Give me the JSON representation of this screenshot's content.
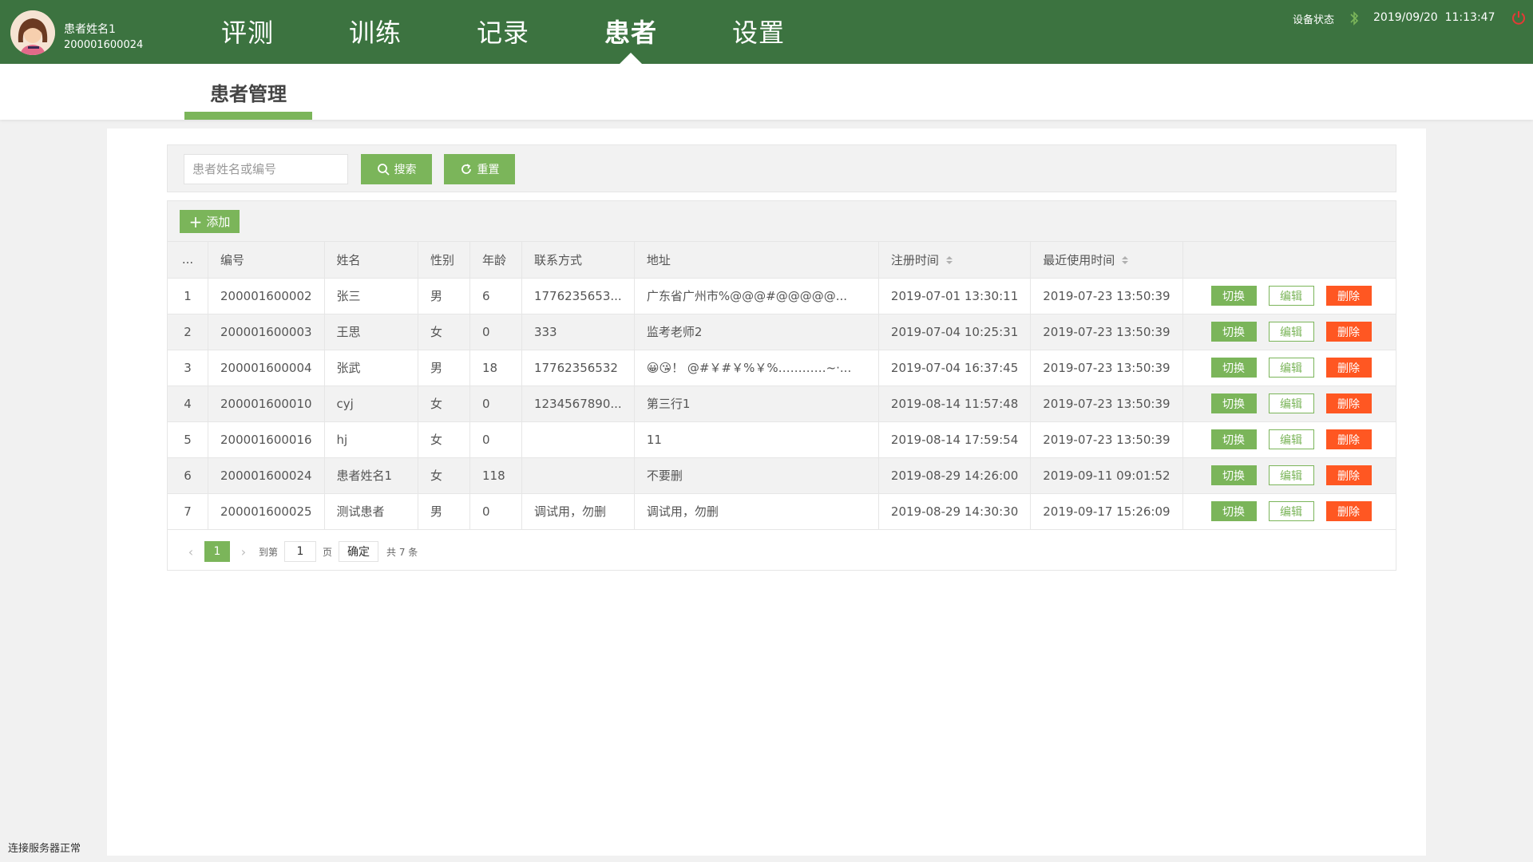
{
  "user": {
    "name": "患者姓名1",
    "id": "200001600024"
  },
  "nav": {
    "items": [
      {
        "label": "评测",
        "active": false
      },
      {
        "label": "训练",
        "active": false
      },
      {
        "label": "记录",
        "active": false
      },
      {
        "label": "患者",
        "active": true
      },
      {
        "label": "设置",
        "active": false
      }
    ]
  },
  "status": {
    "device_label": "设备状态",
    "date": "2019/09/20",
    "time": "11:13:47",
    "power_color": "#e53935",
    "bluetooth_color": "#7bb55a"
  },
  "subnav": {
    "tab": "患者管理"
  },
  "search": {
    "placeholder": "患者姓名或编号",
    "search_label": "搜索",
    "reset_label": "重置"
  },
  "toolbar": {
    "add_label": "添加"
  },
  "table": {
    "columns": [
      "...",
      "编号",
      "姓名",
      "性别",
      "年龄",
      "联系方式",
      "地址",
      "注册时间",
      "最近使用时间",
      ""
    ],
    "rows": [
      {
        "idx": "1",
        "id": "200001600002",
        "name": "张三",
        "gender": "男",
        "age": "6",
        "contact": "1776235653...",
        "address": "广东省广州市%@@@#@@@@@...",
        "registered": "2019-07-01 13:30:11",
        "last_used": "2019-07-23 13:50:39"
      },
      {
        "idx": "2",
        "id": "200001600003",
        "name": "王思",
        "gender": "女",
        "age": "0",
        "contact": "333",
        "address": "监考老师2",
        "registered": "2019-07-04 10:25:31",
        "last_used": "2019-07-23 13:50:39"
      },
      {
        "idx": "3",
        "id": "200001600004",
        "name": "张武",
        "gender": "男",
        "age": "18",
        "contact": "17762356532",
        "address": "😀😘！ @#￥#￥%￥%…………~·...",
        "registered": "2019-07-04 16:37:45",
        "last_used": "2019-07-23 13:50:39"
      },
      {
        "idx": "4",
        "id": "200001600010",
        "name": "cyj",
        "gender": "女",
        "age": "0",
        "contact": "1234567890...",
        "address": "第三行1",
        "registered": "2019-08-14 11:57:48",
        "last_used": "2019-07-23 13:50:39"
      },
      {
        "idx": "5",
        "id": "200001600016",
        "name": "hj",
        "gender": "女",
        "age": "0",
        "contact": "",
        "address": "11",
        "registered": "2019-08-14 17:59:54",
        "last_used": "2019-07-23 13:50:39"
      },
      {
        "idx": "6",
        "id": "200001600024",
        "name": "患者姓名1",
        "gender": "女",
        "age": "118",
        "contact": "",
        "address": "不要删",
        "registered": "2019-08-29 14:26:00",
        "last_used": "2019-09-11 09:01:52"
      },
      {
        "idx": "7",
        "id": "200001600025",
        "name": "测试患者",
        "gender": "男",
        "age": "0",
        "contact": "调试用，勿删",
        "address": "调试用，勿删",
        "registered": "2019-08-29 14:30:30",
        "last_used": "2019-09-17 15:26:09"
      }
    ],
    "actions": {
      "switch": "切换",
      "edit": "编辑",
      "delete": "删除"
    }
  },
  "pager": {
    "current": "1",
    "goto_label": "到第",
    "page_value": "1",
    "page_unit": "页",
    "confirm_label": "确定",
    "total": "共 7 条"
  },
  "footer": {
    "status": "连接服务器正常"
  },
  "colors": {
    "header": "#3c7340",
    "accent": "#7bb55a",
    "danger": "#ff5722"
  }
}
